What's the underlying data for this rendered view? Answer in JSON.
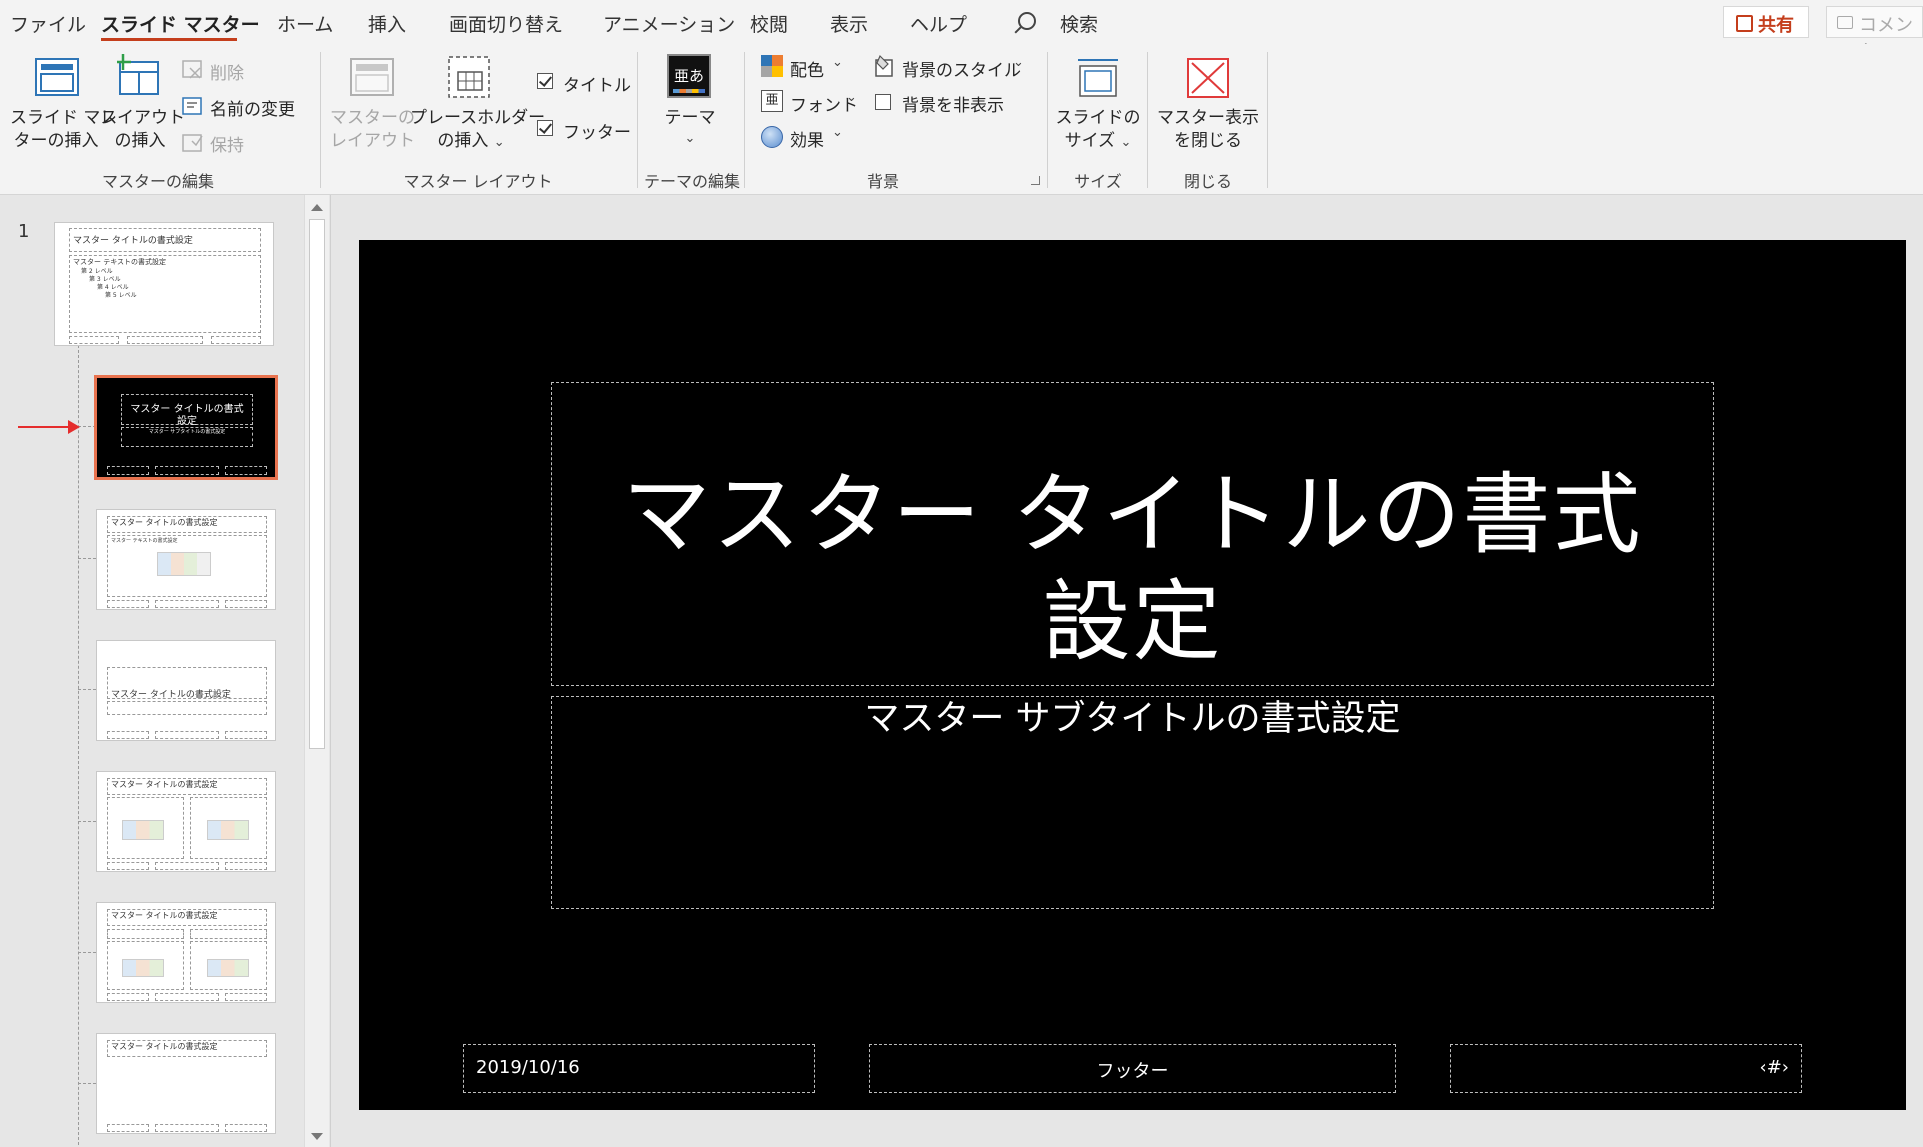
{
  "menu": {
    "tabs": [
      {
        "label": "ファイル"
      },
      {
        "label": "スライド マスター"
      },
      {
        "label": "ホーム"
      },
      {
        "label": "挿入"
      },
      {
        "label": "画面切り替え"
      },
      {
        "label": "アニメーション"
      },
      {
        "label": "校閲"
      },
      {
        "label": "表示"
      },
      {
        "label": "ヘルプ"
      }
    ],
    "search_label": "検索",
    "share_label": "共有",
    "comment_label": "コメント"
  },
  "ribbon": {
    "master_edit": {
      "insert_master_l1": "スライド マス",
      "insert_master_l2": "ターの挿入",
      "insert_layout_l1": "レイアウト",
      "insert_layout_l2": "の挿入",
      "delete": "削除",
      "rename": "名前の変更",
      "preserve": "保持",
      "group_label": "マスターの編集"
    },
    "master_layout": {
      "master_layout_l1": "マスターの",
      "master_layout_l2": "レイアウト",
      "placeholder_l1": "プレースホルダー",
      "placeholder_l2": "の挿入",
      "title_check": "タイトル",
      "footer_check": "フッター",
      "group_label": "マスター レイアウト"
    },
    "theme_edit": {
      "theme": "テーマ",
      "theme_icon_text": "亜あ",
      "group_label": "テーマの編集"
    },
    "background": {
      "colors": "配色",
      "fonts": "フォント",
      "effects": "効果",
      "bg_styles": "背景のスタイル",
      "hide_bg": "背景を非表示",
      "font_icon_text": "亜",
      "group_label": "背景"
    },
    "size": {
      "slide_size_l1": "スライドの",
      "slide_size_l2": "サイズ",
      "group_label": "サイズ"
    },
    "close": {
      "close_l1": "マスター表示",
      "close_l2": "を閉じる",
      "group_label": "閉じる"
    }
  },
  "thumbnails": {
    "slide_number": "1",
    "master_title": "マスター タイトルの書式設定",
    "master_text": "マスター テキストの書式設定",
    "level2": "第 2 レベル",
    "level3": "第 3 レベル",
    "level4": "第 4 レベル",
    "level5": "第 5 レベル",
    "sel_title_l1": "マスター タイトルの書式",
    "sel_title_l2": "設定",
    "sel_sub": "マスター サブタイトルの書式設定"
  },
  "slide": {
    "title_l1": "マスター タイトルの書式",
    "title_l2": "設定",
    "subtitle": "マスター サブタイトルの書式設定",
    "date": "2019/10/16",
    "footer": "フッター",
    "page_number": "‹#›"
  },
  "colors": {
    "accent": "#c43e1c",
    "selection_outline": "#e8734f",
    "arrow": "#e52d2d"
  }
}
